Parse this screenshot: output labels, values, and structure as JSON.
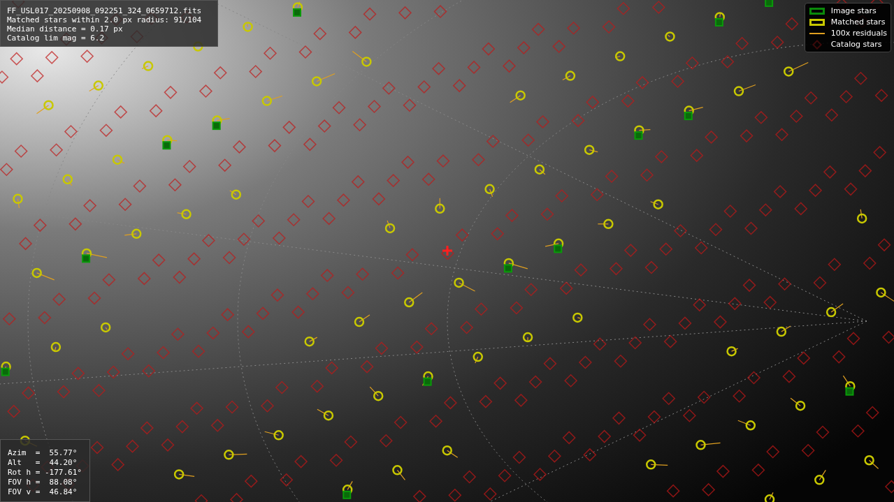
{
  "info_box": {
    "lines": [
      "FF_USL017_20250908_092251_324_0659712.fits",
      "Matched stars within 2.0 px radius: 91/104",
      "Median distance = 0.17 px",
      "Catalog lim mag = 6.2"
    ]
  },
  "legend": [
    {
      "kind": "box",
      "color": "#0a8a0a",
      "label": "Image stars"
    },
    {
      "kind": "box",
      "color": "#c8c800",
      "label": "Matched stars"
    },
    {
      "kind": "line",
      "color": "#e0a020",
      "label": "100x residuals"
    },
    {
      "kind": "diamond",
      "color": "#3a0a0a",
      "label": "Catalog stars"
    }
  ],
  "pointing_box": {
    "lines": [
      "Azim  =  55.77°",
      "Alt   =  44.20°",
      "Rot h = -177.61°",
      "FOV h =  88.08°",
      "FOV v =  46.84°"
    ]
  }
}
